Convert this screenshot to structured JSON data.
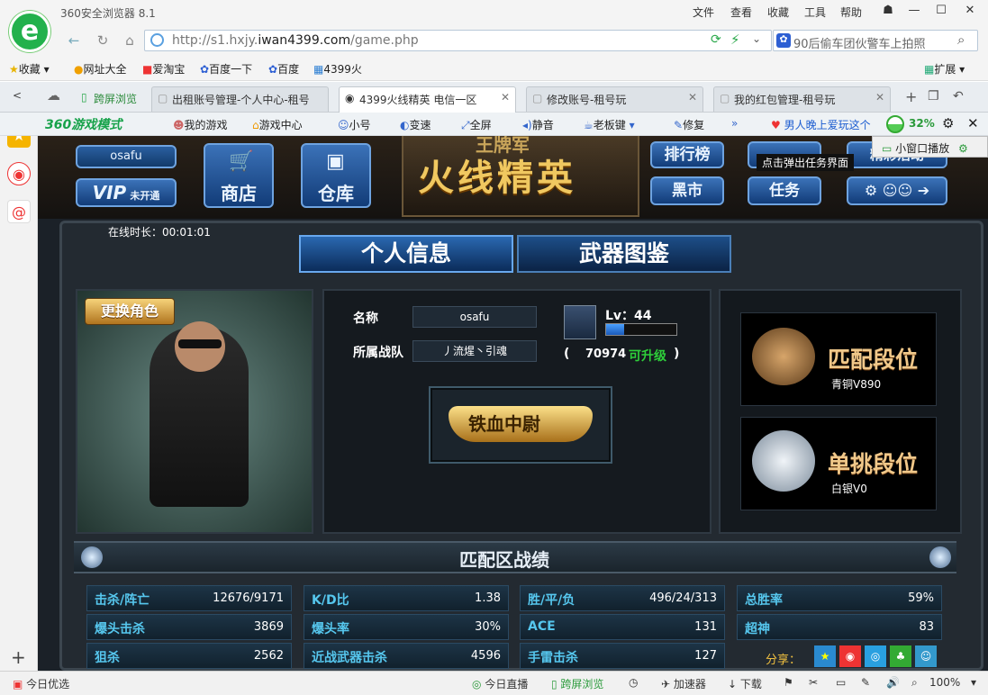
{
  "browser": {
    "title": "360安全浏览器 8.1",
    "menu": [
      "文件",
      "查看",
      "收藏",
      "工具",
      "帮助"
    ],
    "url_host": "http://s1.hxjy.",
    "url_domain": "iwan4399.com",
    "url_path": "/game.php",
    "search_placeholder": "90后偷车团伙警车上拍照",
    "favorites": [
      "收藏",
      "网址大全",
      "爱淘宝",
      "百度一下",
      "百度",
      "4399火"
    ],
    "extend_label": "扩展",
    "tabs": [
      {
        "label": "跨屏浏览"
      },
      {
        "label": "出租账号管理-个人中心-租号"
      },
      {
        "label": "4399火线精英 电信一区"
      },
      {
        "label": "修改账号-租号玩"
      },
      {
        "label": "我的红包管理-租号玩"
      }
    ],
    "game_toolbar": {
      "brand": "360游戏模式",
      "items": [
        "我的游戏",
        "游戏中心",
        "小号",
        "变速",
        "全屏",
        "静音",
        "老板键",
        "修复",
        "»"
      ],
      "promo": "男人晚上爱玩这个",
      "percent": "32%"
    },
    "statusbar": {
      "left": "今日优选",
      "items": [
        "今日直播",
        "跨屏浏览",
        "加速器",
        "下载"
      ],
      "zoom": "100%"
    }
  },
  "game": {
    "username": "osafu",
    "vip_label": "VIP",
    "vip_status": "未开通",
    "shop": "商店",
    "warehouse": "仓库",
    "logo_top": "王牌军",
    "logo": "火线精英",
    "ranking": "排行榜",
    "black_market": "黑市",
    "task": "任务",
    "activity": "精彩活动",
    "tooltip": "点击弹出任务界面",
    "mini_window": "小窗口播放",
    "online_time": "在线时长：00:01:01",
    "tab_personal": "个人信息",
    "tab_weapons": "武器图鉴",
    "change_role": "更换角色",
    "name_label": "名称",
    "name_value": "osafu",
    "team_label": "所属战队",
    "team_value": "丿流煋丶引魂",
    "level": "Lv：44",
    "exp_fill": 0.25,
    "upgrade_open": "(",
    "upgrade_exp": "70974",
    "upgrade_text": "可升级",
    "upgrade_close": ")",
    "rank_title": "铁血中尉",
    "match_rank_label": "匹配段位",
    "match_rank_value": "青铜Ⅴ890",
    "solo_rank_label": "单挑段位",
    "solo_rank_value": "白银Ⅴ0",
    "stats_title": "匹配区战绩",
    "stats": [
      {
        "label": "击杀/阵亡",
        "value": "12676/9171"
      },
      {
        "label": "K/D比",
        "value": "1.38"
      },
      {
        "label": "胜/平/负",
        "value": "496/24/313"
      },
      {
        "label": "总胜率",
        "value": "59%"
      },
      {
        "label": "爆头击杀",
        "value": "3869"
      },
      {
        "label": "爆头率",
        "value": "30%"
      },
      {
        "label": "ACE",
        "value": "131"
      },
      {
        "label": "超神",
        "value": "83"
      },
      {
        "label": "狙杀",
        "value": "2562"
      },
      {
        "label": "近战武器击杀",
        "value": "4596"
      },
      {
        "label": "手雷击杀",
        "value": "127"
      }
    ],
    "share_label": "分享："
  }
}
